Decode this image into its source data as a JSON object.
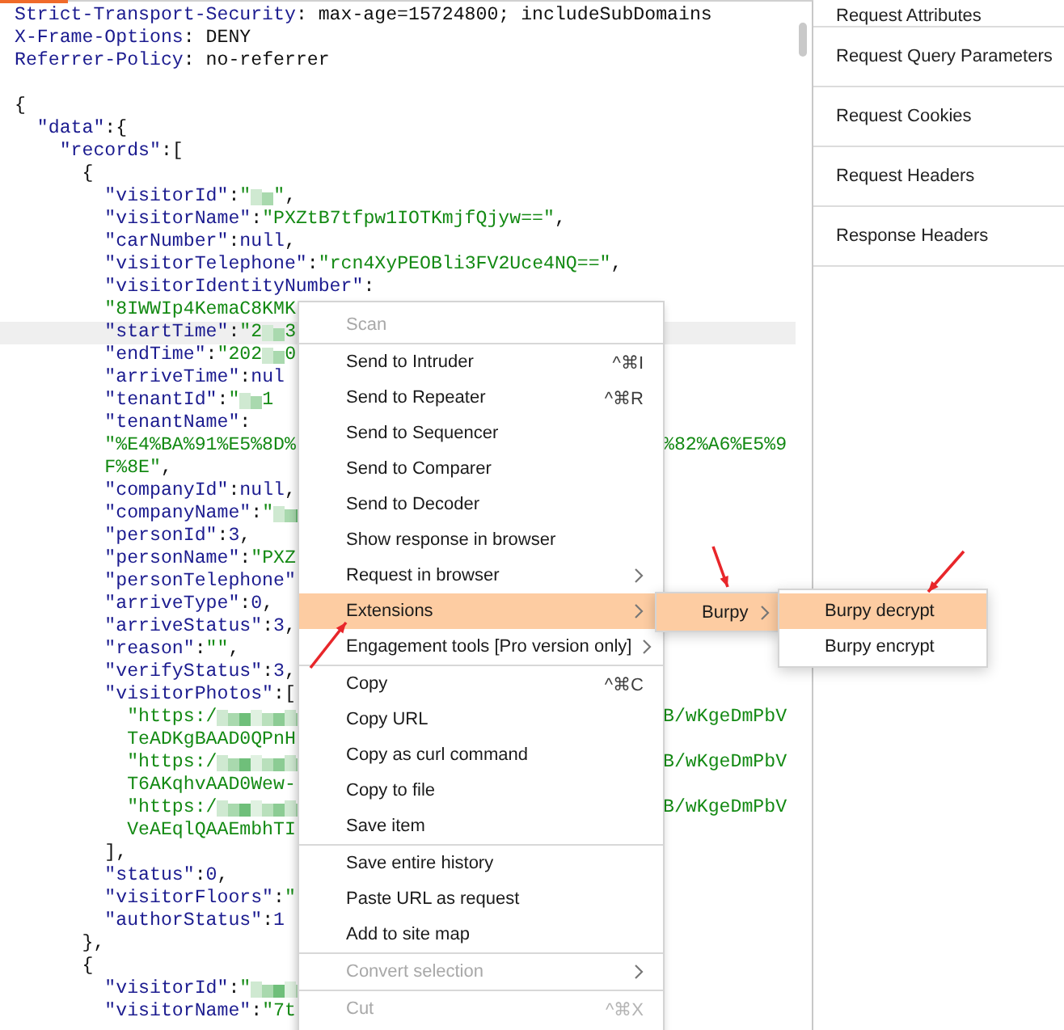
{
  "editor": {
    "lines": [
      {
        "highlighted": false,
        "parts": [
          {
            "kind": "key",
            "text": "Strict-Transport-Security"
          },
          {
            "kind": "punct",
            "text": ": max-age=15724800; includeSubDomains"
          }
        ]
      },
      {
        "highlighted": false,
        "parts": [
          {
            "kind": "key",
            "text": "X-Frame-Options"
          },
          {
            "kind": "punct",
            "text": ": DENY"
          }
        ]
      },
      {
        "highlighted": false,
        "parts": [
          {
            "kind": "key",
            "text": "Referrer-Policy"
          },
          {
            "kind": "punct",
            "text": ": no-referrer"
          }
        ]
      },
      {
        "highlighted": false
      },
      {
        "highlighted": false,
        "parts": [
          {
            "kind": "punct",
            "text": "{"
          }
        ]
      },
      {
        "highlighted": false,
        "parts": [
          {
            "kind": "key",
            "text": "  \"data\""
          },
          {
            "kind": "punct",
            "text": ":{"
          }
        ]
      },
      {
        "highlighted": false,
        "parts": [
          {
            "kind": "key",
            "text": "    \"records\""
          },
          {
            "kind": "punct",
            "text": ":["
          }
        ]
      },
      {
        "highlighted": false,
        "parts": [
          {
            "kind": "punct",
            "text": "      {"
          }
        ]
      },
      {
        "highlighted": false,
        "parts": [
          {
            "kind": "key",
            "text": "        \"visitorId\""
          },
          {
            "kind": "punct",
            "text": ":"
          },
          {
            "kind": "str",
            "text": "\""
          },
          {
            "kind": "redacted"
          },
          {
            "kind": "str",
            "text": "\""
          },
          {
            "kind": "punct",
            "text": ","
          }
        ]
      },
      {
        "highlighted": false,
        "parts": [
          {
            "kind": "key",
            "text": "        \"visitorName\""
          },
          {
            "kind": "punct",
            "text": ":"
          },
          {
            "kind": "str",
            "text": "\"PXZtB7tfpw1IOTKmjfQjyw==\""
          },
          {
            "kind": "punct",
            "text": ","
          }
        ]
      },
      {
        "highlighted": false,
        "parts": [
          {
            "kind": "key",
            "text": "        \"carNumber\""
          },
          {
            "kind": "punct",
            "text": ":"
          },
          {
            "kind": "lit",
            "text": "null"
          },
          {
            "kind": "punct",
            "text": ","
          }
        ]
      },
      {
        "highlighted": false,
        "parts": [
          {
            "kind": "key",
            "text": "        \"visitorTelephone\""
          },
          {
            "kind": "punct",
            "text": ":"
          },
          {
            "kind": "str",
            "text": "\"rcn4XyPEOBli3FV2Uce4NQ==\""
          },
          {
            "kind": "punct",
            "text": ","
          }
        ]
      },
      {
        "highlighted": false,
        "parts": [
          {
            "kind": "key",
            "text": "        \"visitorIdentityNumber\""
          },
          {
            "kind": "punct",
            "text": ":"
          }
        ]
      },
      {
        "highlighted": false,
        "parts": [
          {
            "kind": "str",
            "text": "        \"8IWWIp4KemaC8KMK"
          }
        ]
      },
      {
        "highlighted": true,
        "parts": [
          {
            "kind": "key",
            "text": "        \"startTime\""
          },
          {
            "kind": "punct",
            "text": ":"
          },
          {
            "kind": "str",
            "text": "\"2"
          },
          {
            "kind": "redacted"
          },
          {
            "kind": "str",
            "text": "3"
          }
        ]
      },
      {
        "highlighted": false,
        "parts": [
          {
            "kind": "key",
            "text": "        \"endTime\""
          },
          {
            "kind": "punct",
            "text": ":"
          },
          {
            "kind": "str",
            "text": "\"202"
          },
          {
            "kind": "redacted"
          },
          {
            "kind": "str",
            "text": "0"
          }
        ]
      },
      {
        "highlighted": false,
        "parts": [
          {
            "kind": "key",
            "text": "        \"arriveTime\""
          },
          {
            "kind": "punct",
            "text": ":"
          },
          {
            "kind": "lit",
            "text": "nul"
          }
        ]
      },
      {
        "highlighted": false,
        "parts": [
          {
            "kind": "key",
            "text": "        \"tenantId\""
          },
          {
            "kind": "punct",
            "text": ":"
          },
          {
            "kind": "str",
            "text": "\""
          },
          {
            "kind": "redacted"
          },
          {
            "kind": "str",
            "text": "1"
          }
        ]
      },
      {
        "highlighted": false,
        "parts": [
          {
            "kind": "key",
            "text": "        \"tenantName\""
          },
          {
            "kind": "punct",
            "text": ":"
          }
        ]
      },
      {
        "highlighted": false,
        "parts": [
          {
            "kind": "str",
            "text": "        \"%E4%BA%91%E5%8D%"
          }
        ],
        "tail": "%82%A6%E5%9"
      },
      {
        "highlighted": false,
        "parts": [
          {
            "kind": "str",
            "text": "        F%8E\""
          },
          {
            "kind": "punct",
            "text": ","
          }
        ]
      },
      {
        "highlighted": false,
        "parts": [
          {
            "kind": "key",
            "text": "        \"companyId\""
          },
          {
            "kind": "punct",
            "text": ":"
          },
          {
            "kind": "lit",
            "text": "null"
          },
          {
            "kind": "punct",
            "text": ","
          }
        ]
      },
      {
        "highlighted": false,
        "parts": [
          {
            "kind": "key",
            "text": "        \"companyName\""
          },
          {
            "kind": "punct",
            "text": ":"
          },
          {
            "kind": "str",
            "text": "\""
          },
          {
            "kind": "redacted"
          }
        ]
      },
      {
        "highlighted": false,
        "parts": [
          {
            "kind": "key",
            "text": "        \"personId\""
          },
          {
            "kind": "punct",
            "text": ":"
          },
          {
            "kind": "lit",
            "text": "3"
          },
          {
            "kind": "punct",
            "text": ","
          }
        ]
      },
      {
        "highlighted": false,
        "parts": [
          {
            "kind": "key",
            "text": "        \"personName\""
          },
          {
            "kind": "punct",
            "text": ":"
          },
          {
            "kind": "str",
            "text": "\"PXZ"
          }
        ]
      },
      {
        "highlighted": false,
        "parts": [
          {
            "kind": "key",
            "text": "        \"personTelephone\""
          }
        ]
      },
      {
        "highlighted": false,
        "parts": [
          {
            "kind": "key",
            "text": "        \"arriveType\""
          },
          {
            "kind": "punct",
            "text": ":"
          },
          {
            "kind": "lit",
            "text": "0"
          },
          {
            "kind": "punct",
            "text": ","
          }
        ]
      },
      {
        "highlighted": false,
        "parts": [
          {
            "kind": "key",
            "text": "        \"arriveStatus\""
          },
          {
            "kind": "punct",
            "text": ":"
          },
          {
            "kind": "lit",
            "text": "3"
          },
          {
            "kind": "punct",
            "text": ","
          }
        ]
      },
      {
        "highlighted": false,
        "parts": [
          {
            "kind": "key",
            "text": "        \"reason\""
          },
          {
            "kind": "punct",
            "text": ":"
          },
          {
            "kind": "str",
            "text": "\"\""
          },
          {
            "kind": "punct",
            "text": ","
          }
        ]
      },
      {
        "highlighted": false,
        "parts": [
          {
            "kind": "key",
            "text": "        \"verifyStatus\""
          },
          {
            "kind": "punct",
            "text": ":"
          },
          {
            "kind": "lit",
            "text": "3"
          },
          {
            "kind": "punct",
            "text": ","
          }
        ]
      },
      {
        "highlighted": false,
        "parts": [
          {
            "kind": "key",
            "text": "        \"visitorPhotos\""
          },
          {
            "kind": "punct",
            "text": ":["
          }
        ]
      },
      {
        "highlighted": false,
        "parts": [
          {
            "kind": "str",
            "text": "          \"https:/"
          },
          {
            "kind": "redacted"
          }
        ],
        "tail": "B/wKgeDmPbV"
      },
      {
        "highlighted": false,
        "parts": [
          {
            "kind": "str",
            "text": "          TeADKgBAAD0QPnH"
          }
        ]
      },
      {
        "highlighted": false,
        "parts": [
          {
            "kind": "str",
            "text": "          \"https:/"
          },
          {
            "kind": "redacted"
          }
        ],
        "tail": "B/wKgeDmPbV"
      },
      {
        "highlighted": false,
        "parts": [
          {
            "kind": "str",
            "text": "          T6AKqhvAAD0Wew-"
          }
        ]
      },
      {
        "highlighted": false,
        "parts": [
          {
            "kind": "str",
            "text": "          \"https:/"
          },
          {
            "kind": "redacted"
          }
        ],
        "tail": "B/wKgeDmPbV"
      },
      {
        "highlighted": false,
        "parts": [
          {
            "kind": "str",
            "text": "          VeAEqlQAAEmbhTI"
          }
        ]
      },
      {
        "highlighted": false,
        "parts": [
          {
            "kind": "punct",
            "text": "        ],"
          }
        ]
      },
      {
        "highlighted": false,
        "parts": [
          {
            "kind": "key",
            "text": "        \"status\""
          },
          {
            "kind": "punct",
            "text": ":"
          },
          {
            "kind": "lit",
            "text": "0"
          },
          {
            "kind": "punct",
            "text": ","
          }
        ]
      },
      {
        "highlighted": false,
        "parts": [
          {
            "kind": "key",
            "text": "        \"visitorFloors\""
          },
          {
            "kind": "punct",
            "text": ":"
          },
          {
            "kind": "str",
            "text": "\""
          }
        ]
      },
      {
        "highlighted": false,
        "parts": [
          {
            "kind": "key",
            "text": "        \"authorStatus\""
          },
          {
            "kind": "punct",
            "text": ":"
          },
          {
            "kind": "lit",
            "text": "1"
          }
        ]
      },
      {
        "highlighted": false,
        "parts": [
          {
            "kind": "punct",
            "text": "      },"
          }
        ]
      },
      {
        "highlighted": false,
        "parts": [
          {
            "kind": "punct",
            "text": "      {"
          }
        ]
      },
      {
        "highlighted": false,
        "parts": [
          {
            "kind": "key",
            "text": "        \"visitorId\""
          },
          {
            "kind": "punct",
            "text": ":"
          },
          {
            "kind": "str",
            "text": "\""
          },
          {
            "kind": "redacted"
          }
        ]
      },
      {
        "highlighted": false,
        "parts": [
          {
            "kind": "key",
            "text": "        \"visitorName\""
          },
          {
            "kind": "punct",
            "text": ":"
          },
          {
            "kind": "str",
            "text": "\"7t"
          }
        ]
      }
    ]
  },
  "sidebar": {
    "items": [
      {
        "label": "Request Attributes"
      },
      {
        "label": "Request Query Parameters"
      },
      {
        "label": "Request Cookies"
      },
      {
        "label": "Request Headers"
      },
      {
        "label": "Response Headers"
      }
    ]
  },
  "context_menu": {
    "groups": [
      [
        {
          "label": "Scan",
          "disabled": true,
          "highlighted": false
        }
      ],
      [
        {
          "label": "Send to Intruder",
          "shortcut": "^⌘I",
          "disabled": false,
          "highlighted": false
        },
        {
          "label": "Send to Repeater",
          "shortcut": "^⌘R",
          "disabled": false,
          "highlighted": false
        },
        {
          "label": "Send to Sequencer",
          "disabled": false,
          "highlighted": false
        },
        {
          "label": "Send to Comparer",
          "disabled": false,
          "highlighted": false
        },
        {
          "label": "Send to Decoder",
          "disabled": false,
          "highlighted": false
        },
        {
          "label": "Show response in browser",
          "disabled": false,
          "highlighted": false
        },
        {
          "label": "Request in browser",
          "submenu": true,
          "disabled": false,
          "highlighted": false
        },
        {
          "label": "Extensions",
          "submenu": true,
          "disabled": false,
          "highlighted": true
        },
        {
          "label": "Engagement tools [Pro version only]",
          "submenu": true,
          "disabled": false,
          "highlighted": false
        }
      ],
      [
        {
          "label": "Copy",
          "shortcut": "^⌘C",
          "disabled": false,
          "highlighted": false
        },
        {
          "label": "Copy URL",
          "disabled": false,
          "highlighted": false
        },
        {
          "label": "Copy as curl command",
          "disabled": false,
          "highlighted": false
        },
        {
          "label": "Copy to file",
          "disabled": false,
          "highlighted": false
        },
        {
          "label": "Save item",
          "disabled": false,
          "highlighted": false
        }
      ],
      [
        {
          "label": "Save entire history",
          "disabled": false,
          "highlighted": false
        },
        {
          "label": "Paste URL as request",
          "disabled": false,
          "highlighted": false
        },
        {
          "label": "Add to site map",
          "disabled": false,
          "highlighted": false
        }
      ],
      [
        {
          "label": "Convert selection",
          "submenu": true,
          "disabled": true,
          "highlighted": false
        }
      ],
      [
        {
          "label": "Cut",
          "shortcut": "^⌘X",
          "disabled": true,
          "highlighted": false
        }
      ]
    ]
  },
  "extensions_submenu": {
    "items": [
      {
        "label": "Burpy",
        "submenu": true,
        "highlighted": true
      }
    ]
  },
  "burpy_submenu": {
    "items": [
      {
        "label": "Burpy decrypt",
        "highlighted": true
      },
      {
        "label": "Burpy encrypt",
        "highlighted": false
      }
    ]
  }
}
